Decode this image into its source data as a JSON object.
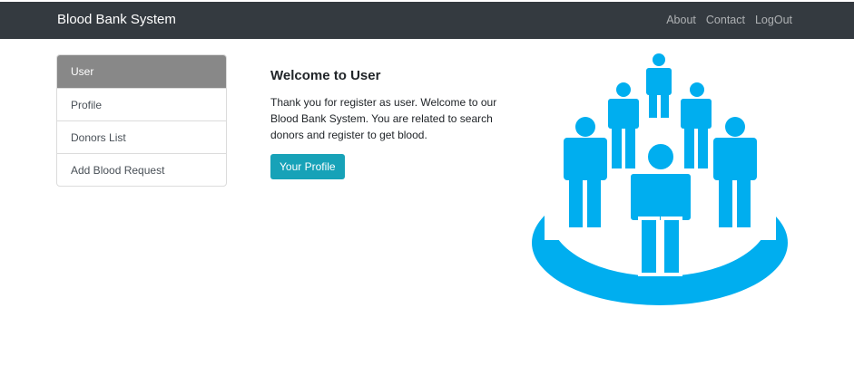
{
  "navbar": {
    "brand": "Blood Bank System",
    "links": [
      "About",
      "Contact",
      "LogOut"
    ]
  },
  "sidebar": {
    "items": [
      {
        "label": "User",
        "active": true
      },
      {
        "label": "Profile",
        "active": false
      },
      {
        "label": "Donors List",
        "active": false
      },
      {
        "label": "Add Blood Request",
        "active": false
      }
    ]
  },
  "main": {
    "title": "Welcome to User",
    "text": "Thank you for register as user. Welcome to our Blood Bank System. You are related to search donors and register to get blood.",
    "button_label": "Your Profile"
  },
  "hero": {
    "icon": "community-people-icon",
    "color": "#00aeef"
  }
}
